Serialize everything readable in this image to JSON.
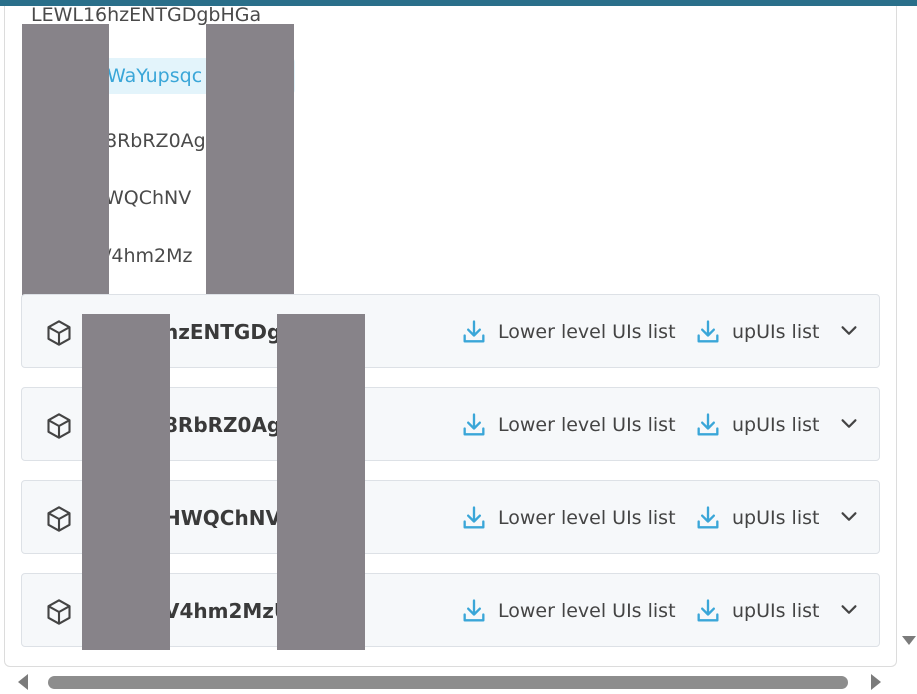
{
  "list": {
    "items": [
      {
        "label": "LEWL16hzENTGDgbHGa",
        "selected": false
      },
      {
        "label": "WaYupsqc",
        "selected": true
      },
      {
        "label": "8RbRZ0Ag",
        "selected": false
      },
      {
        "label": "WQChNV",
        "selected": false
      },
      {
        "label": "/4hm2Mz",
        "selected": false
      }
    ]
  },
  "rows": [
    {
      "title": "hzENTGDg",
      "lower_label": "Lower level UIs list",
      "up_label": "upUIs list"
    },
    {
      "title": "8RbRZ0Ag",
      "lower_label": "Lower level UIs list",
      "up_label": "upUIs list"
    },
    {
      "title": "HWQChNV",
      "lower_label": "Lower level UIs list",
      "up_label": "upUIs list"
    },
    {
      "title": "V4hm2MzU",
      "lower_label": "Lower level UIs list",
      "up_label": "upUIs list"
    }
  ],
  "icons": {
    "row_icon": "cube-icon",
    "download": "download-icon",
    "expand": "chevron-down-icon"
  },
  "colors": {
    "accent": "#3aa6d8",
    "top_bar": "#2a6f8a",
    "row_bg": "#f6f8fa",
    "redaction": "#878389"
  }
}
